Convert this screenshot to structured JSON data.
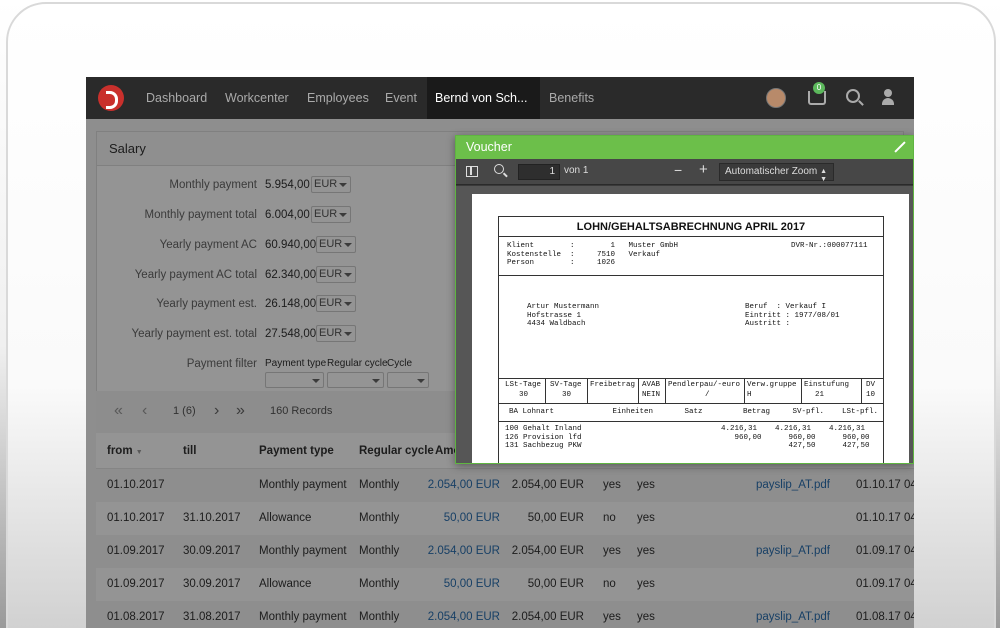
{
  "nav": {
    "items": [
      "Dashboard",
      "Workcenter",
      "Employees",
      "Event"
    ],
    "active": "Bernd von Sch...",
    "last": "Benefits",
    "basket_count": "0"
  },
  "salary": {
    "title": "Salary",
    "fields": [
      {
        "label": "Monthly payment",
        "value": "5.954,00",
        "currency": "EUR"
      },
      {
        "label": "Monthly payment total",
        "value": "6.004,00",
        "currency": "EUR"
      },
      {
        "label": "Yearly payment AC",
        "value": "60.940,00",
        "currency": "EUR"
      },
      {
        "label": "Yearly payment AC total",
        "value": "62.340,00",
        "currency": "EUR"
      },
      {
        "label": "Yearly payment est.",
        "value": "26.148,00",
        "currency": "EUR"
      },
      {
        "label": "Yearly payment est. total",
        "value": "27.548,00",
        "currency": "EUR"
      }
    ],
    "filter": {
      "label": "Payment filter",
      "payment_type": "Payment type",
      "regular_cycle": "Regular cycle",
      "cycle": "Cycle"
    }
  },
  "pager": {
    "page": "1 (6)",
    "records": "160 Records"
  },
  "table": {
    "headers": [
      "from",
      "till",
      "Payment type",
      "Regular cycle",
      "Amo"
    ],
    "rows": [
      {
        "from": "01.10.2017",
        "till": "",
        "type": "Monthly payment",
        "cycle": "Monthly",
        "amount": "2.054,00 EUR",
        "amount2": "2.054,00 EUR",
        "a": "yes",
        "b": "yes",
        "file": "payslip_AT.pdf",
        "date": "01.10.17 04"
      },
      {
        "from": "01.10.2017",
        "till": "31.10.2017",
        "type": "Allowance",
        "cycle": "Monthly",
        "amount": "50,00 EUR",
        "amount2": "50,00 EUR",
        "a": "no",
        "b": "yes",
        "file": "",
        "date": "01.10.17 04"
      },
      {
        "from": "01.09.2017",
        "till": "30.09.2017",
        "type": "Monthly payment",
        "cycle": "Monthly",
        "amount": "2.054,00 EUR",
        "amount2": "2.054,00 EUR",
        "a": "yes",
        "b": "yes",
        "file": "payslip_AT.pdf",
        "date": "01.09.17 04"
      },
      {
        "from": "01.09.2017",
        "till": "30.09.2017",
        "type": "Allowance",
        "cycle": "Monthly",
        "amount": "50,00 EUR",
        "amount2": "50,00 EUR",
        "a": "no",
        "b": "yes",
        "file": "",
        "date": "01.09.17 04"
      },
      {
        "from": "01.08.2017",
        "till": "31.08.2017",
        "type": "Monthly payment",
        "cycle": "Monthly",
        "amount": "2.054,00 EUR",
        "amount2": "2.054,00 EUR",
        "a": "yes",
        "b": "yes",
        "file": "payslip_AT.pdf",
        "date": "01.08.17 04"
      }
    ]
  },
  "voucher": {
    "title": "Voucher",
    "page": "1",
    "of": "von 1",
    "zoom": "Automatischer Zoom",
    "slip": {
      "title": "LOHN/GEHALTSABRECHNUNG APRIL 2017",
      "header_left": "Klient        :        1   Muster GmbH\nKostenstelle  :     7510   Verkauf\nPerson        :     1026",
      "header_right": "DVR-Nr.:000077111",
      "addr_left": "Artur Mustermann\nHofstrasse 1\n4434 Waldbach",
      "addr_right": "Beruf  : Verkauf I\nEintritt : 1977/08/01\nAustritt :",
      "tax_cols": [
        {
          "h": "LSt-Tage",
          "v": "30"
        },
        {
          "h": "SV-Tage",
          "v": "30"
        },
        {
          "h": "Freibetrag",
          "v": ""
        },
        {
          "h": "AVAB",
          "v": "NEIN"
        },
        {
          "h": "Pendlerpau/-euro",
          "v": "/"
        },
        {
          "h": "Verw.gruppe",
          "v": "H"
        },
        {
          "h": "Einstufung",
          "v": "21"
        },
        {
          "h": "DV",
          "v": "10"
        }
      ],
      "lines_header": "BA Lohnart             Einheiten       Satz         Betrag     SV-pfl.    LSt-pfl.",
      "lines": "100 Gehalt Inland                               4.216,31    4.216,31    4.216,31\n126 Provision lfd                                  960,00      960,00      960,00\n131 Sachbezug PKW                                              427,50      427,50"
    }
  }
}
